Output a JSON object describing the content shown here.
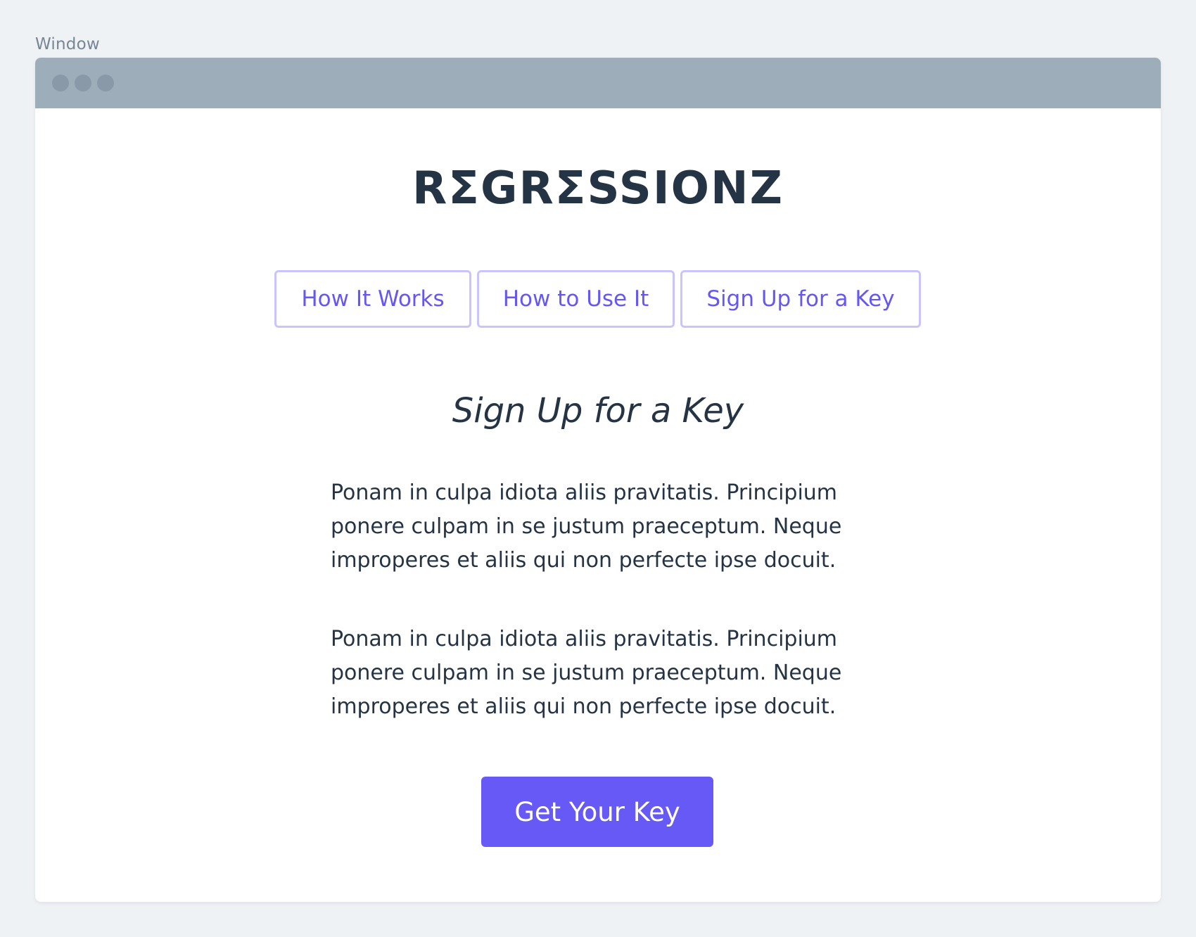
{
  "window": {
    "caption": "Window"
  },
  "site": {
    "logo": "RΣGRΣSSIONZ"
  },
  "nav": {
    "items": [
      {
        "label": "How It Works"
      },
      {
        "label": "How to Use It"
      },
      {
        "label": "Sign Up for a Key"
      }
    ]
  },
  "main": {
    "title": "Sign Up for a Key",
    "paragraphs": [
      "Ponam in culpa idiota aliis pravitatis. Principium ponere culpam in se justum praeceptum. Neque improperes et aliis qui non perfecte ipse docuit.",
      "Ponam in culpa idiota aliis pravitatis. Principium ponere culpam in se justum praeceptum. Neque improperes et aliis qui non perfecte ipse docuit."
    ],
    "cta_label": "Get Your Key"
  },
  "colors": {
    "accent": "#6659f5",
    "nav_border": "#c9c4fb",
    "text": "#243444",
    "titlebar": "#9eadba",
    "background": "#eff2f5"
  }
}
